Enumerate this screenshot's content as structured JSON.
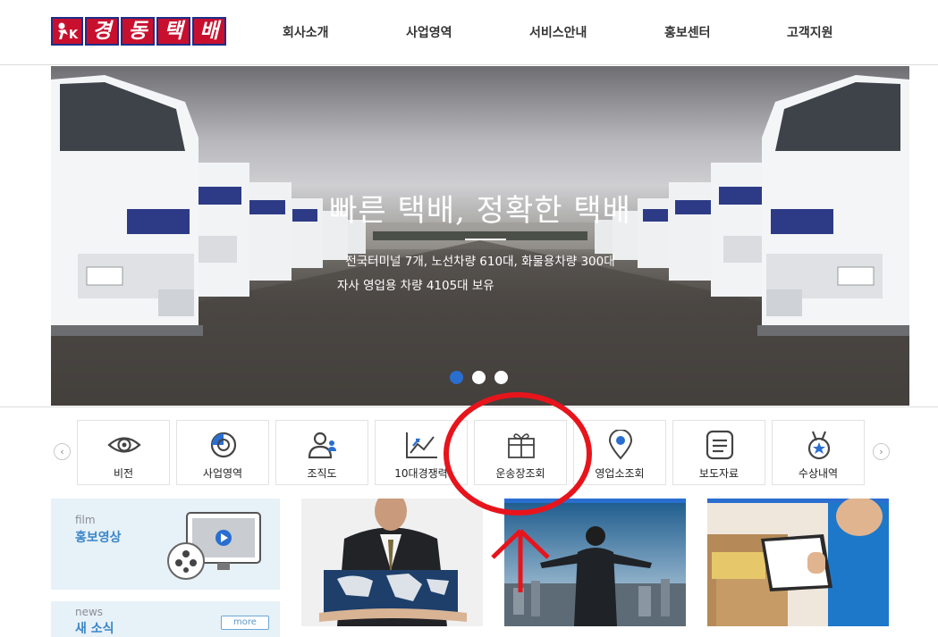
{
  "brand": {
    "logo_chars": [
      "경",
      "동",
      "택",
      "배"
    ],
    "brand_color": "#c8102e",
    "border_color": "#1d2f8a"
  },
  "nav": {
    "items": [
      "회사소개",
      "사업영역",
      "서비스안내",
      "홍보센터",
      "고객지원"
    ]
  },
  "hero": {
    "title": "빠른 택배, 정확한 택배",
    "subtitle_line1": "전국터미널 7개, 노선차량 610대, 화물용차량 300대",
    "subtitle_line2": "자사 영업용 차량 4105대 보유",
    "slides": 3,
    "active_slide": 1,
    "active_dot_color": "#2a6ed0"
  },
  "quick_menu": {
    "prev_icon": "chevron-left-icon",
    "next_icon": "chevron-right-icon",
    "items": [
      {
        "label": "비전",
        "icon": "eye-icon"
      },
      {
        "label": "사업영역",
        "icon": "pie-chart-icon"
      },
      {
        "label": "조직도",
        "icon": "people-icon"
      },
      {
        "label": "10대경쟁력",
        "icon": "trend-chart-icon"
      },
      {
        "label": "운송장조회",
        "icon": "gift-box-icon"
      },
      {
        "label": "영업소조회",
        "icon": "location-pin-icon"
      },
      {
        "label": "보도자료",
        "icon": "document-icon"
      },
      {
        "label": "수상내역",
        "icon": "medal-icon"
      }
    ]
  },
  "film": {
    "en": "film",
    "ko": "홍보영상",
    "icon": "film-reel-monitor-icon"
  },
  "news": {
    "en": "news",
    "ko": "새 소식",
    "more": "more"
  },
  "accent_colors": {
    "blue": "#3a86c8",
    "annotation_red": "#e8141c"
  }
}
